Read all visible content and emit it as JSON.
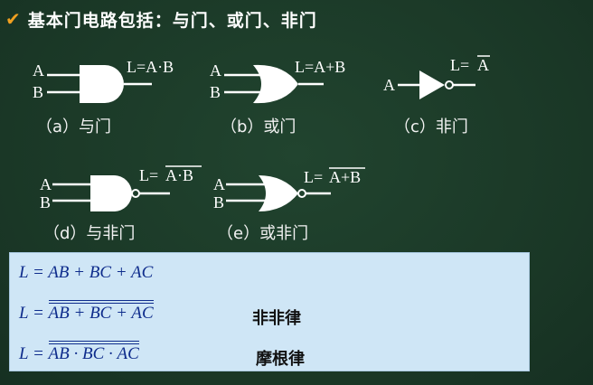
{
  "title": "基本门电路包括：与门、或门、非门",
  "colors": {
    "background": "#1c3b2a",
    "check": "#f0a020",
    "formula_bg": "#cfe6f6",
    "formula_text": "#0e2c8c"
  },
  "gates": {
    "a": {
      "in1": "A",
      "in2": "B",
      "out": "L=A·B",
      "caption": "（a）与门"
    },
    "b": {
      "in1": "A",
      "in2": "B",
      "out": "L=A+B",
      "caption": "（b）或门"
    },
    "c": {
      "in1": "A",
      "out_l": "L=",
      "out_bar": "A",
      "caption": "（c）非门"
    },
    "d": {
      "in1": "A",
      "in2": "B",
      "out_l": "L=",
      "out_bar": "A·B",
      "caption": "（d）与非门"
    },
    "e": {
      "in1": "A",
      "in2": "B",
      "out_l": "L=",
      "out_bar": "A+B",
      "caption": "（e）或非门"
    }
  },
  "formulas": {
    "f1": {
      "lhs": "L = ",
      "rhs": "AB + BC + AC"
    },
    "f2": {
      "lhs": "L = ",
      "rhs": "AB + BC + AC",
      "law": "非非律"
    },
    "f3": {
      "lhs": "L = ",
      "t1": "AB",
      "dot1": " · ",
      "t2": "BC",
      "dot2": " · ",
      "t3": "AC",
      "law": "摩根律"
    }
  }
}
